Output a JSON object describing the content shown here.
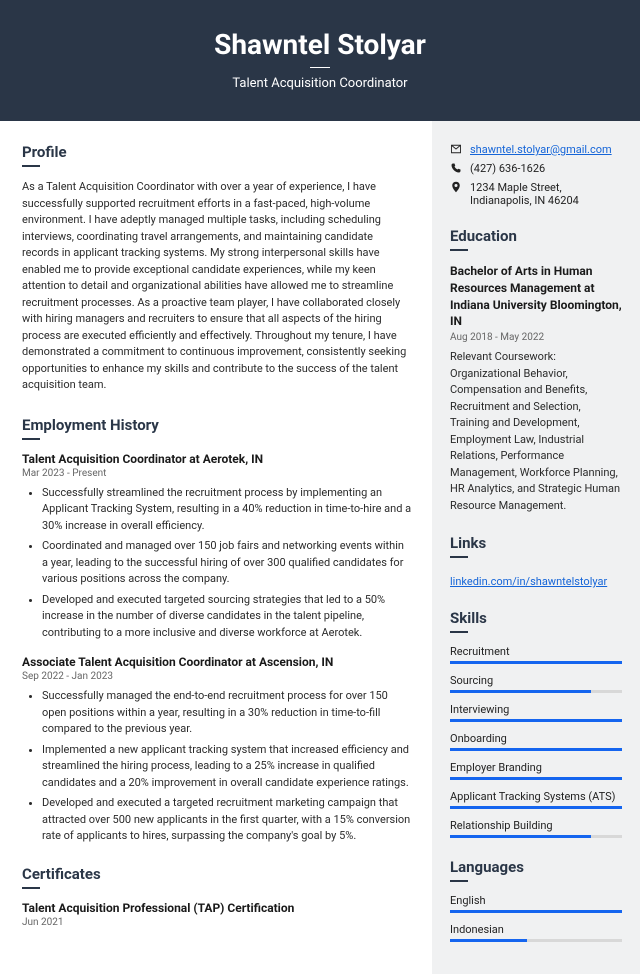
{
  "header": {
    "name": "Shawntel Stolyar",
    "title": "Talent Acquisition Coordinator"
  },
  "profile": {
    "heading": "Profile",
    "text": "As a Talent Acquisition Coordinator with over a year of experience, I have successfully supported recruitment efforts in a fast-paced, high-volume environment. I have adeptly managed multiple tasks, including scheduling interviews, coordinating travel arrangements, and maintaining candidate records in applicant tracking systems. My strong interpersonal skills have enabled me to provide exceptional candidate experiences, while my keen attention to detail and organizational abilities have allowed me to streamline recruitment processes. As a proactive team player, I have collaborated closely with hiring managers and recruiters to ensure that all aspects of the hiring process are executed efficiently and effectively. Throughout my tenure, I have demonstrated a commitment to continuous improvement, consistently seeking opportunities to enhance my skills and contribute to the success of the talent acquisition team."
  },
  "employment": {
    "heading": "Employment History",
    "jobs": [
      {
        "title": "Talent Acquisition Coordinator at Aerotek, IN",
        "dates": "Mar 2023 - Present",
        "bullets": [
          "Successfully streamlined the recruitment process by implementing an Applicant Tracking System, resulting in a 40% reduction in time-to-hire and a 30% increase in overall efficiency.",
          "Coordinated and managed over 150 job fairs and networking events within a year, leading to the successful hiring of over 300 qualified candidates for various positions across the company.",
          "Developed and executed targeted sourcing strategies that led to a 50% increase in the number of diverse candidates in the talent pipeline, contributing to a more inclusive and diverse workforce at Aerotek."
        ]
      },
      {
        "title": "Associate Talent Acquisition Coordinator at Ascension, IN",
        "dates": "Sep 2022 - Jan 2023",
        "bullets": [
          "Successfully managed the end-to-end recruitment process for over 150 open positions within a year, resulting in a 30% reduction in time-to-fill compared to the previous year.",
          "Implemented a new applicant tracking system that increased efficiency and streamlined the hiring process, leading to a 25% increase in qualified candidates and a 20% improvement in overall candidate experience ratings.",
          "Developed and executed a targeted recruitment marketing campaign that attracted over 500 new applicants in the first quarter, with a 15% conversion rate of applicants to hires, surpassing the company's goal by 5%."
        ]
      }
    ]
  },
  "certificates": {
    "heading": "Certificates",
    "items": [
      {
        "title": "Talent Acquisition Professional (TAP) Certification",
        "dates": "Jun 2021"
      }
    ]
  },
  "contact": {
    "email": "shawntel.stolyar@gmail.com",
    "phone": "(427) 636-1626",
    "address": "1234 Maple Street, Indianapolis, IN 46204"
  },
  "education": {
    "heading": "Education",
    "degree": "Bachelor of Arts in Human Resources Management at Indiana University Bloomington, IN",
    "dates": "Aug 2018 - May 2022",
    "desc": "Relevant Coursework: Organizational Behavior, Compensation and Benefits, Recruitment and Selection, Training and Development, Employment Law, Industrial Relations, Performance Management, Workforce Planning, HR Analytics, and Strategic Human Resource Management."
  },
  "links": {
    "heading": "Links",
    "items": [
      {
        "text": "linkedin.com/in/shawntelstolyar"
      }
    ]
  },
  "skills": {
    "heading": "Skills",
    "items": [
      {
        "name": "Recruitment",
        "level": 100
      },
      {
        "name": "Sourcing",
        "level": 82
      },
      {
        "name": "Interviewing",
        "level": 100
      },
      {
        "name": "Onboarding",
        "level": 100
      },
      {
        "name": "Employer Branding",
        "level": 100
      },
      {
        "name": "Applicant Tracking Systems (ATS)",
        "level": 100
      },
      {
        "name": "Relationship Building",
        "level": 82
      }
    ]
  },
  "languages": {
    "heading": "Languages",
    "items": [
      {
        "name": "English",
        "level": 100
      },
      {
        "name": "Indonesian",
        "level": 45
      }
    ]
  }
}
